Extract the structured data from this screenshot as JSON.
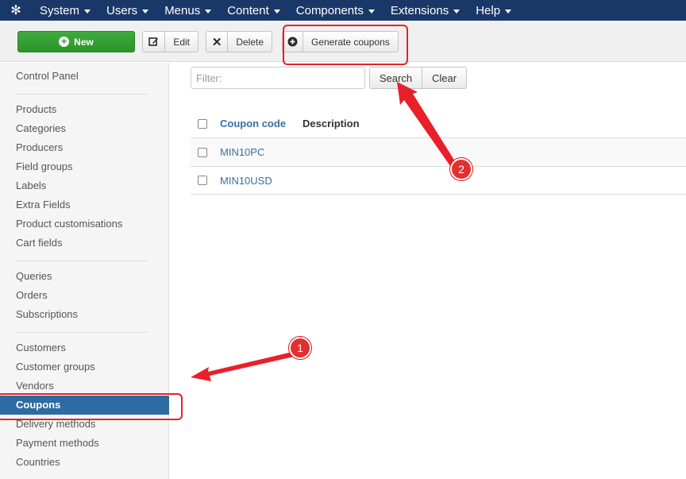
{
  "navbar": {
    "brand_icon": "joomla-icon",
    "items": [
      {
        "label": "System"
      },
      {
        "label": "Users"
      },
      {
        "label": "Menus"
      },
      {
        "label": "Content"
      },
      {
        "label": "Components"
      },
      {
        "label": "Extensions"
      },
      {
        "label": "Help"
      }
    ]
  },
  "toolbar": {
    "new_label": "New",
    "edit_label": "Edit",
    "delete_label": "Delete",
    "generate_label": "Generate coupons"
  },
  "sidebar": {
    "items": [
      {
        "label": "Control Panel"
      },
      {
        "label": "Products"
      },
      {
        "label": "Categories"
      },
      {
        "label": "Producers"
      },
      {
        "label": "Field groups"
      },
      {
        "label": "Labels"
      },
      {
        "label": "Extra Fields"
      },
      {
        "label": "Product customisations"
      },
      {
        "label": "Cart fields"
      },
      {
        "label": "Queries"
      },
      {
        "label": "Orders"
      },
      {
        "label": "Subscriptions"
      },
      {
        "label": "Customers"
      },
      {
        "label": "Customer groups"
      },
      {
        "label": "Vendors"
      },
      {
        "label": "Coupons"
      },
      {
        "label": "Delivery methods"
      },
      {
        "label": "Payment methods"
      },
      {
        "label": "Countries"
      }
    ],
    "active": "Coupons"
  },
  "filter": {
    "placeholder": "Filter:",
    "search_label": "Search",
    "clear_label": "Clear"
  },
  "table": {
    "columns": [
      "Coupon code",
      "Description"
    ],
    "rows": [
      {
        "code": "MIN10PC",
        "description": ""
      },
      {
        "code": "MIN10USD",
        "description": ""
      }
    ]
  },
  "annotations": {
    "badge1": "1",
    "badge2": "2",
    "color": "#e8202a"
  },
  "colors": {
    "navbar": "#1a3867",
    "new_button": "#2a962a",
    "active_sidebar": "#2d6ca2",
    "link": "#3a6fa5"
  }
}
